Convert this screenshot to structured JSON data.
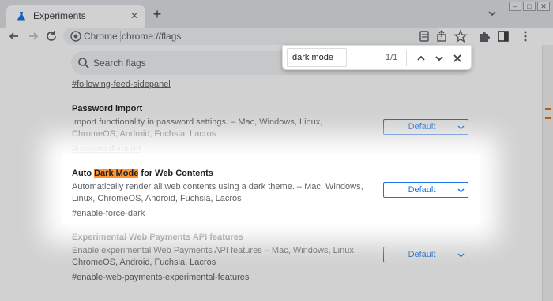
{
  "tab": {
    "title": "Experiments",
    "close": "✕",
    "new_tab": "+"
  },
  "window_controls": [
    "–",
    "□",
    "✕"
  ],
  "toolbar": {
    "origin": "Chrome",
    "url": "chrome://flags"
  },
  "search": {
    "placeholder": "Search flags"
  },
  "find_bar": {
    "query": "dark mode",
    "count": "1/1"
  },
  "partial_top_link": "#following-feed-sidepanel",
  "flags": [
    {
      "title": "Password import",
      "description": "Import functionality in password settings. – Mac, Windows, Linux, ChromeOS, Android, Fuchsia, Lacros",
      "link": "#password-import",
      "selected": "Default"
    },
    {
      "title_before": "Auto ",
      "title_highlight": "Dark Mode",
      "title_after": " for Web Contents",
      "description": "Automatically render all web contents using a dark theme. – Mac, Windows, Linux, ChromeOS, Android, Fuchsia, Lacros",
      "link": "#enable-force-dark",
      "selected": "Default"
    },
    {
      "title": "Experimental Web Payments API features",
      "description": "Enable experimental Web Payments API features – Mac, Windows, Linux, ChromeOS, Android, Fuchsia, Lacros",
      "link": "#enable-web-payments-experimental-features",
      "selected": "Default"
    }
  ],
  "colors": {
    "accent": "#1a73e8",
    "highlight": "#ff9632",
    "scroll_marker": "#e8710a"
  }
}
